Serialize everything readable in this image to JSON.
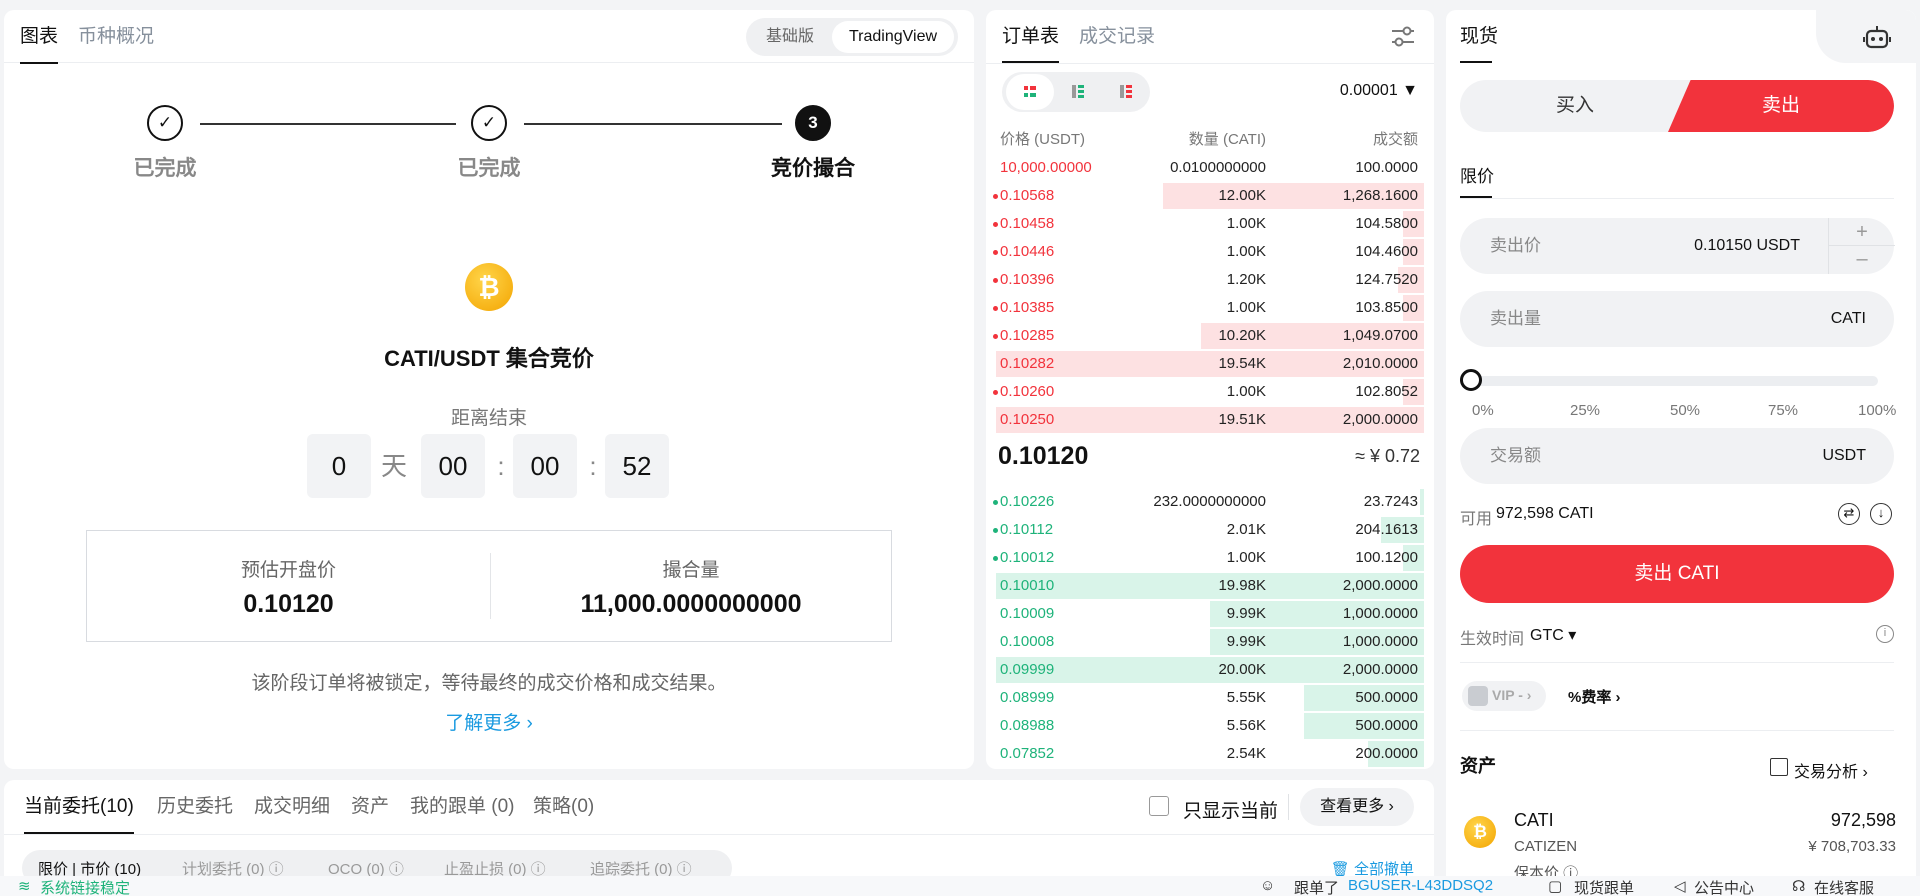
{
  "chart_tabs": [
    "图表",
    "币种概况"
  ],
  "view_toggle": [
    "基础版",
    "TradingView"
  ],
  "steps": [
    {
      "label": "已完成",
      "mark": "✓"
    },
    {
      "label": "已完成",
      "mark": "✓"
    },
    {
      "label": "竞价撮合",
      "mark": "3"
    }
  ],
  "coin_symbol": "₿",
  "auction_title": "CATI/USDT 集合竞价",
  "countdown": {
    "label": "距离结束",
    "days": "0",
    "day_unit": "天",
    "hours": "00",
    "sep1": ":",
    "minutes": "00",
    "sep2": ":",
    "seconds": "52"
  },
  "info": {
    "open_label": "预估开盘价",
    "open_value": "0.10120",
    "match_label": "撮合量",
    "match_value": "11,000.0000000000"
  },
  "note": "该阶段订单将被锁定，等待最终的成交价格和成交结果。",
  "learn_more": "了解更多 ›",
  "orderbook": {
    "tabs": [
      "订单表",
      "成交记录"
    ],
    "precision": "0.00001 ▼",
    "headers": [
      "价格 (USDT)",
      "数量 (CATI)",
      "成交额"
    ],
    "asks": [
      {
        "price": "10,000.00000",
        "qty": "0.0100000000",
        "amt": "100.0000",
        "depth": 0,
        "dot": false
      },
      {
        "price": "0.10568",
        "qty": "12.00K",
        "amt": "1,268.1600",
        "depth": 0.61,
        "dot": true
      },
      {
        "price": "0.10458",
        "qty": "1.00K",
        "amt": "104.5800",
        "depth": 0.05,
        "dot": true
      },
      {
        "price": "0.10446",
        "qty": "1.00K",
        "amt": "104.4600",
        "depth": 0.05,
        "dot": true
      },
      {
        "price": "0.10396",
        "qty": "1.20K",
        "amt": "124.7520",
        "depth": 0.06,
        "dot": true
      },
      {
        "price": "0.10385",
        "qty": "1.00K",
        "amt": "103.8500",
        "depth": 0.05,
        "dot": true
      },
      {
        "price": "0.10285",
        "qty": "10.20K",
        "amt": "1,049.0700",
        "depth": 0.52,
        "dot": true
      },
      {
        "price": "0.10282",
        "qty": "19.54K",
        "amt": "2,010.0000",
        "depth": 1.0,
        "dot": false
      },
      {
        "price": "0.10260",
        "qty": "1.00K",
        "amt": "102.8052",
        "depth": 0.05,
        "dot": true
      },
      {
        "price": "0.10250",
        "qty": "19.51K",
        "amt": "2,000.0000",
        "depth": 1.0,
        "dot": false
      }
    ],
    "last_price": "0.10120",
    "last_cny": "≈ ¥ 0.72",
    "bids": [
      {
        "price": "0.10226",
        "qty": "232.0000000000",
        "amt": "23.7243",
        "depth": 0.01,
        "dot": true
      },
      {
        "price": "0.10112",
        "qty": "2.01K",
        "amt": "204.1613",
        "depth": 0.1,
        "dot": true
      },
      {
        "price": "0.10012",
        "qty": "1.00K",
        "amt": "100.1200",
        "depth": 0.05,
        "dot": true
      },
      {
        "price": "0.10010",
        "qty": "19.98K",
        "amt": "2,000.0000",
        "depth": 1.0,
        "dot": false
      },
      {
        "price": "0.10009",
        "qty": "9.99K",
        "amt": "1,000.0000",
        "depth": 0.5,
        "dot": false
      },
      {
        "price": "0.10008",
        "qty": "9.99K",
        "amt": "1,000.0000",
        "depth": 0.5,
        "dot": false
      },
      {
        "price": "0.09999",
        "qty": "20.00K",
        "amt": "2,000.0000",
        "depth": 1.0,
        "dot": false
      },
      {
        "price": "0.08999",
        "qty": "5.55K",
        "amt": "500.0000",
        "depth": 0.28,
        "dot": false
      },
      {
        "price": "0.08988",
        "qty": "5.56K",
        "amt": "500.0000",
        "depth": 0.28,
        "dot": false
      },
      {
        "price": "0.07852",
        "qty": "2.54K",
        "amt": "200.0000",
        "depth": 0.13,
        "dot": false
      }
    ]
  },
  "trade": {
    "tab": "现货",
    "buy": "买入",
    "sell": "卖出",
    "order_type": "限价",
    "price_label": "卖出价",
    "price_value": "0.10150 USDT",
    "qty_label": "卖出量",
    "qty_unit": "CATI",
    "slider_marks": [
      "0%",
      "25%",
      "50%",
      "75%",
      "100%"
    ],
    "slider_value": 0,
    "total_label": "交易额",
    "total_unit": "USDT",
    "avail_label": "可用",
    "avail_value": "972,598 CATI",
    "submit": "卖出 CATI",
    "tif_label": "生效时间",
    "tif_value": "GTC ▾",
    "vip": "VIP - ›",
    "fee": "%费率 ›",
    "assets_title": "资产",
    "analysis": "交易分析 ›",
    "asset_symbol": "CATI",
    "asset_name": "CATIZEN",
    "asset_qty": "972,598",
    "asset_cny": "¥ 708,703.33",
    "asset_more": "保本价 ⓘ"
  },
  "bottom": {
    "tabs": [
      "当前委托(10)",
      "历史委托",
      "成交明细",
      "资产",
      "我的跟单 (0)",
      "策略(0)"
    ],
    "only_current": "只显示当前",
    "view_more": "查看更多 ›",
    "sub_tabs": [
      "限价 | 市价 (10)",
      "计划委托 (0) ⓘ",
      "OCO (0) ⓘ",
      "止盈止损 (0) ⓘ",
      "追踪委托 (0) ⓘ"
    ],
    "cancel_all": "全部撤单"
  },
  "status": {
    "connection": "系统链接稳定",
    "copy_trade": "跟单了",
    "user": "BGUSER-L43DDSQ2",
    "spot_copy": "现货跟单",
    "announcements": "公告中心",
    "support": "在线客服"
  },
  "colors": {
    "ask": "#f2333c",
    "bid": "#1eb37a",
    "ask_bar": "#fde1e2",
    "bid_bar": "#d9f4e9",
    "link": "#1a9ae0"
  }
}
